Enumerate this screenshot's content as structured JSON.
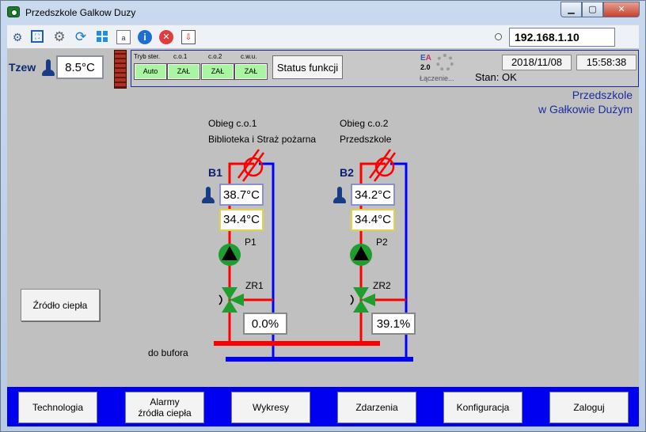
{
  "window": {
    "title": "Przedszkole Galkow Duzy"
  },
  "toolbar": {
    "ip_address": "192.168.1.10",
    "icons": [
      "network-icon",
      "fullscreen-icon",
      "settings-gear-icon",
      "refresh-icon",
      "windows-icon",
      "document-icon",
      "info-icon",
      "stop-icon",
      "export-icon"
    ]
  },
  "header": {
    "tzew_label": "Tzew",
    "tzew_value": "8.5°C",
    "modes": [
      {
        "head": "Tryb ster.",
        "value": "Auto"
      },
      {
        "head": "c.o.1",
        "value": "ZAŁ"
      },
      {
        "head": "c.o.2",
        "value": "ZAŁ"
      },
      {
        "head": "c.w.u.",
        "value": "ZAŁ"
      }
    ],
    "status_button": "Status funkcji",
    "logo_e": "E",
    "logo_a": "A",
    "logo_version": "2.0",
    "connecting_text": "Łączenie...",
    "date": "2018/11/08",
    "time": "15:58:38",
    "state": "Stan: OK"
  },
  "site": {
    "line1": "Przedszkole",
    "line2": "w Gałkowie Dużym"
  },
  "source_button": "Źródło ciepła",
  "circuits": [
    {
      "name_line1": "Obieg c.o.1",
      "name_line2": "Biblioteka i Straż pożarna",
      "boiler_label": "B1",
      "supply_temp": "38.7°C",
      "set_temp": "34.4°C",
      "pump_label": "P1",
      "valve_label": "ZR1",
      "valve_pct": "0.0%"
    },
    {
      "name_line1": "Obieg c.o.2",
      "name_line2": "Przedszkole",
      "boiler_label": "B2",
      "supply_temp": "34.2°C",
      "set_temp": "34.4°C",
      "pump_label": "P2",
      "valve_label": "ZR2",
      "valve_pct": "39.1%"
    }
  ],
  "buffer_label": "do bufora",
  "nav": [
    {
      "label": "Technologia"
    },
    {
      "label": "Alarmy\nźródła ciepła"
    },
    {
      "label": "Wykresy"
    },
    {
      "label": "Zdarzenia"
    },
    {
      "label": "Konfiguracja"
    },
    {
      "label": "Zaloguj"
    }
  ],
  "colors": {
    "supply_pipe": "#ff0000",
    "return_pipe": "#0000ff",
    "pump_green": "#1f9e2f",
    "nav_bar": "#0000f0"
  }
}
